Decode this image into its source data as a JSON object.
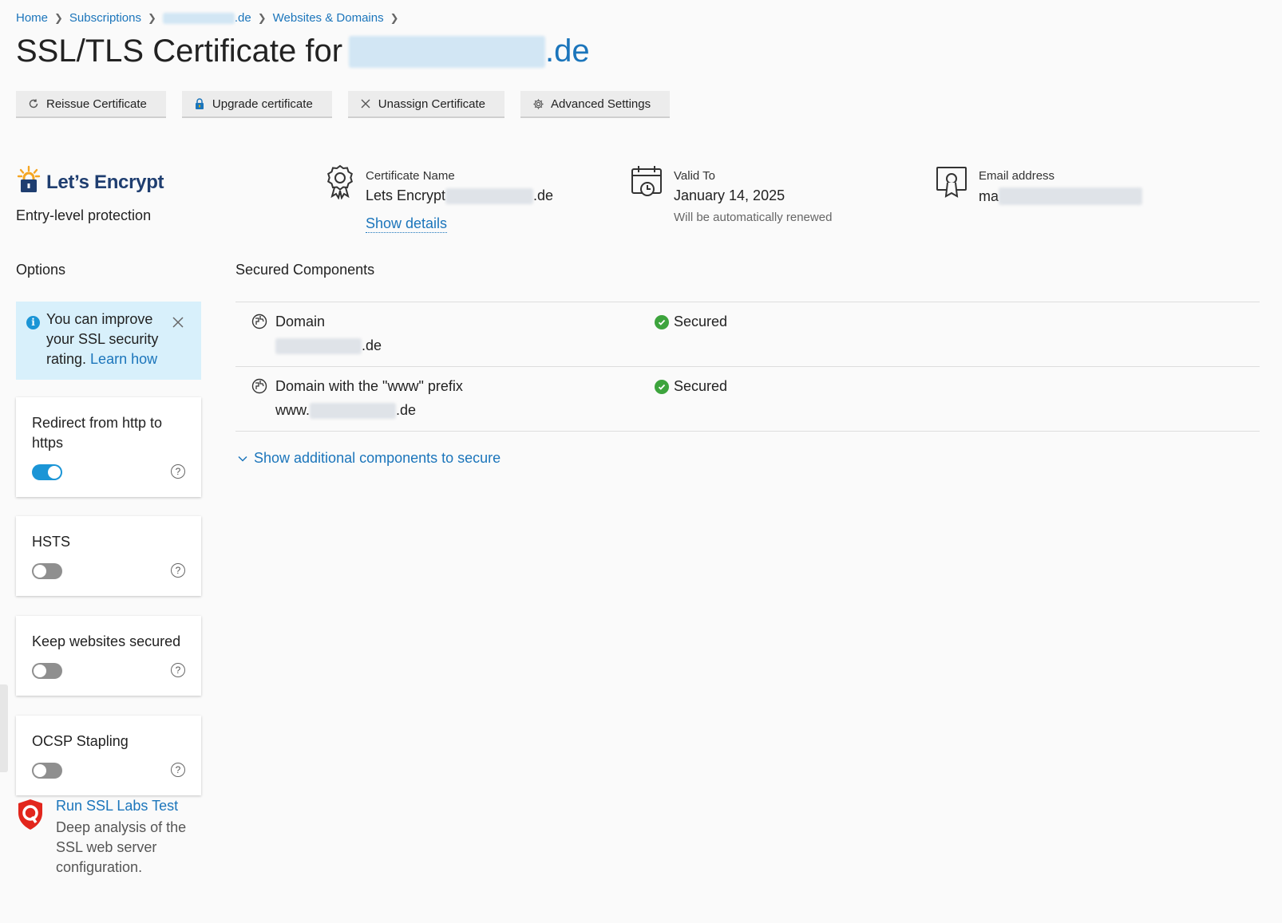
{
  "breadcrumb": {
    "home": "Home",
    "subscriptions": "Subscriptions",
    "domain_suffix": ".de",
    "websites": "Websites & Domains"
  },
  "page": {
    "title_prefix": "SSL/TLS Certificate for",
    "title_domain_suffix": ".de"
  },
  "toolbar": {
    "reissue": "Reissue Certificate",
    "upgrade": "Upgrade certificate",
    "unassign": "Unassign Certificate",
    "advanced": "Advanced Settings"
  },
  "provider": {
    "name": "Let’s Encrypt",
    "level": "Entry-level protection"
  },
  "certificate": {
    "name_label": "Certificate Name",
    "name_prefix": "Lets Encrypt",
    "name_suffix": ".de",
    "show_details": "Show details",
    "valid_label": "Valid To",
    "valid_value": "January 14, 2025",
    "valid_note": "Will be automatically renewed",
    "email_label": "Email address",
    "email_prefix": "ma"
  },
  "options": {
    "title": "Options",
    "notice_text": "You can improve your SSL security rating.",
    "notice_link": "Learn how",
    "items": [
      {
        "label": "Redirect from http to https",
        "enabled": true
      },
      {
        "label": "HSTS",
        "enabled": false
      },
      {
        "label": "Keep websites secured",
        "enabled": false
      },
      {
        "label": "OCSP Stapling",
        "enabled": false
      }
    ],
    "help_glyph": "?"
  },
  "ssl_labs": {
    "title": "Run SSL Labs Test",
    "desc": "Deep analysis of the SSL web server configuration."
  },
  "secured": {
    "title": "Secured Components",
    "rows": [
      {
        "name": "Domain",
        "domain_prefix": "",
        "domain_suffix": ".de",
        "status": "Secured"
      },
      {
        "name": "Domain with the \"www\" prefix",
        "domain_prefix": "www.",
        "domain_suffix": ".de",
        "status": "Secured"
      }
    ],
    "show_additional": "Show additional components to secure"
  },
  "colors": {
    "link": "#1b75bb",
    "toggle_on": "#1b95d6",
    "secured": "#3da43d",
    "notice_bg": "#d8f0fb"
  }
}
